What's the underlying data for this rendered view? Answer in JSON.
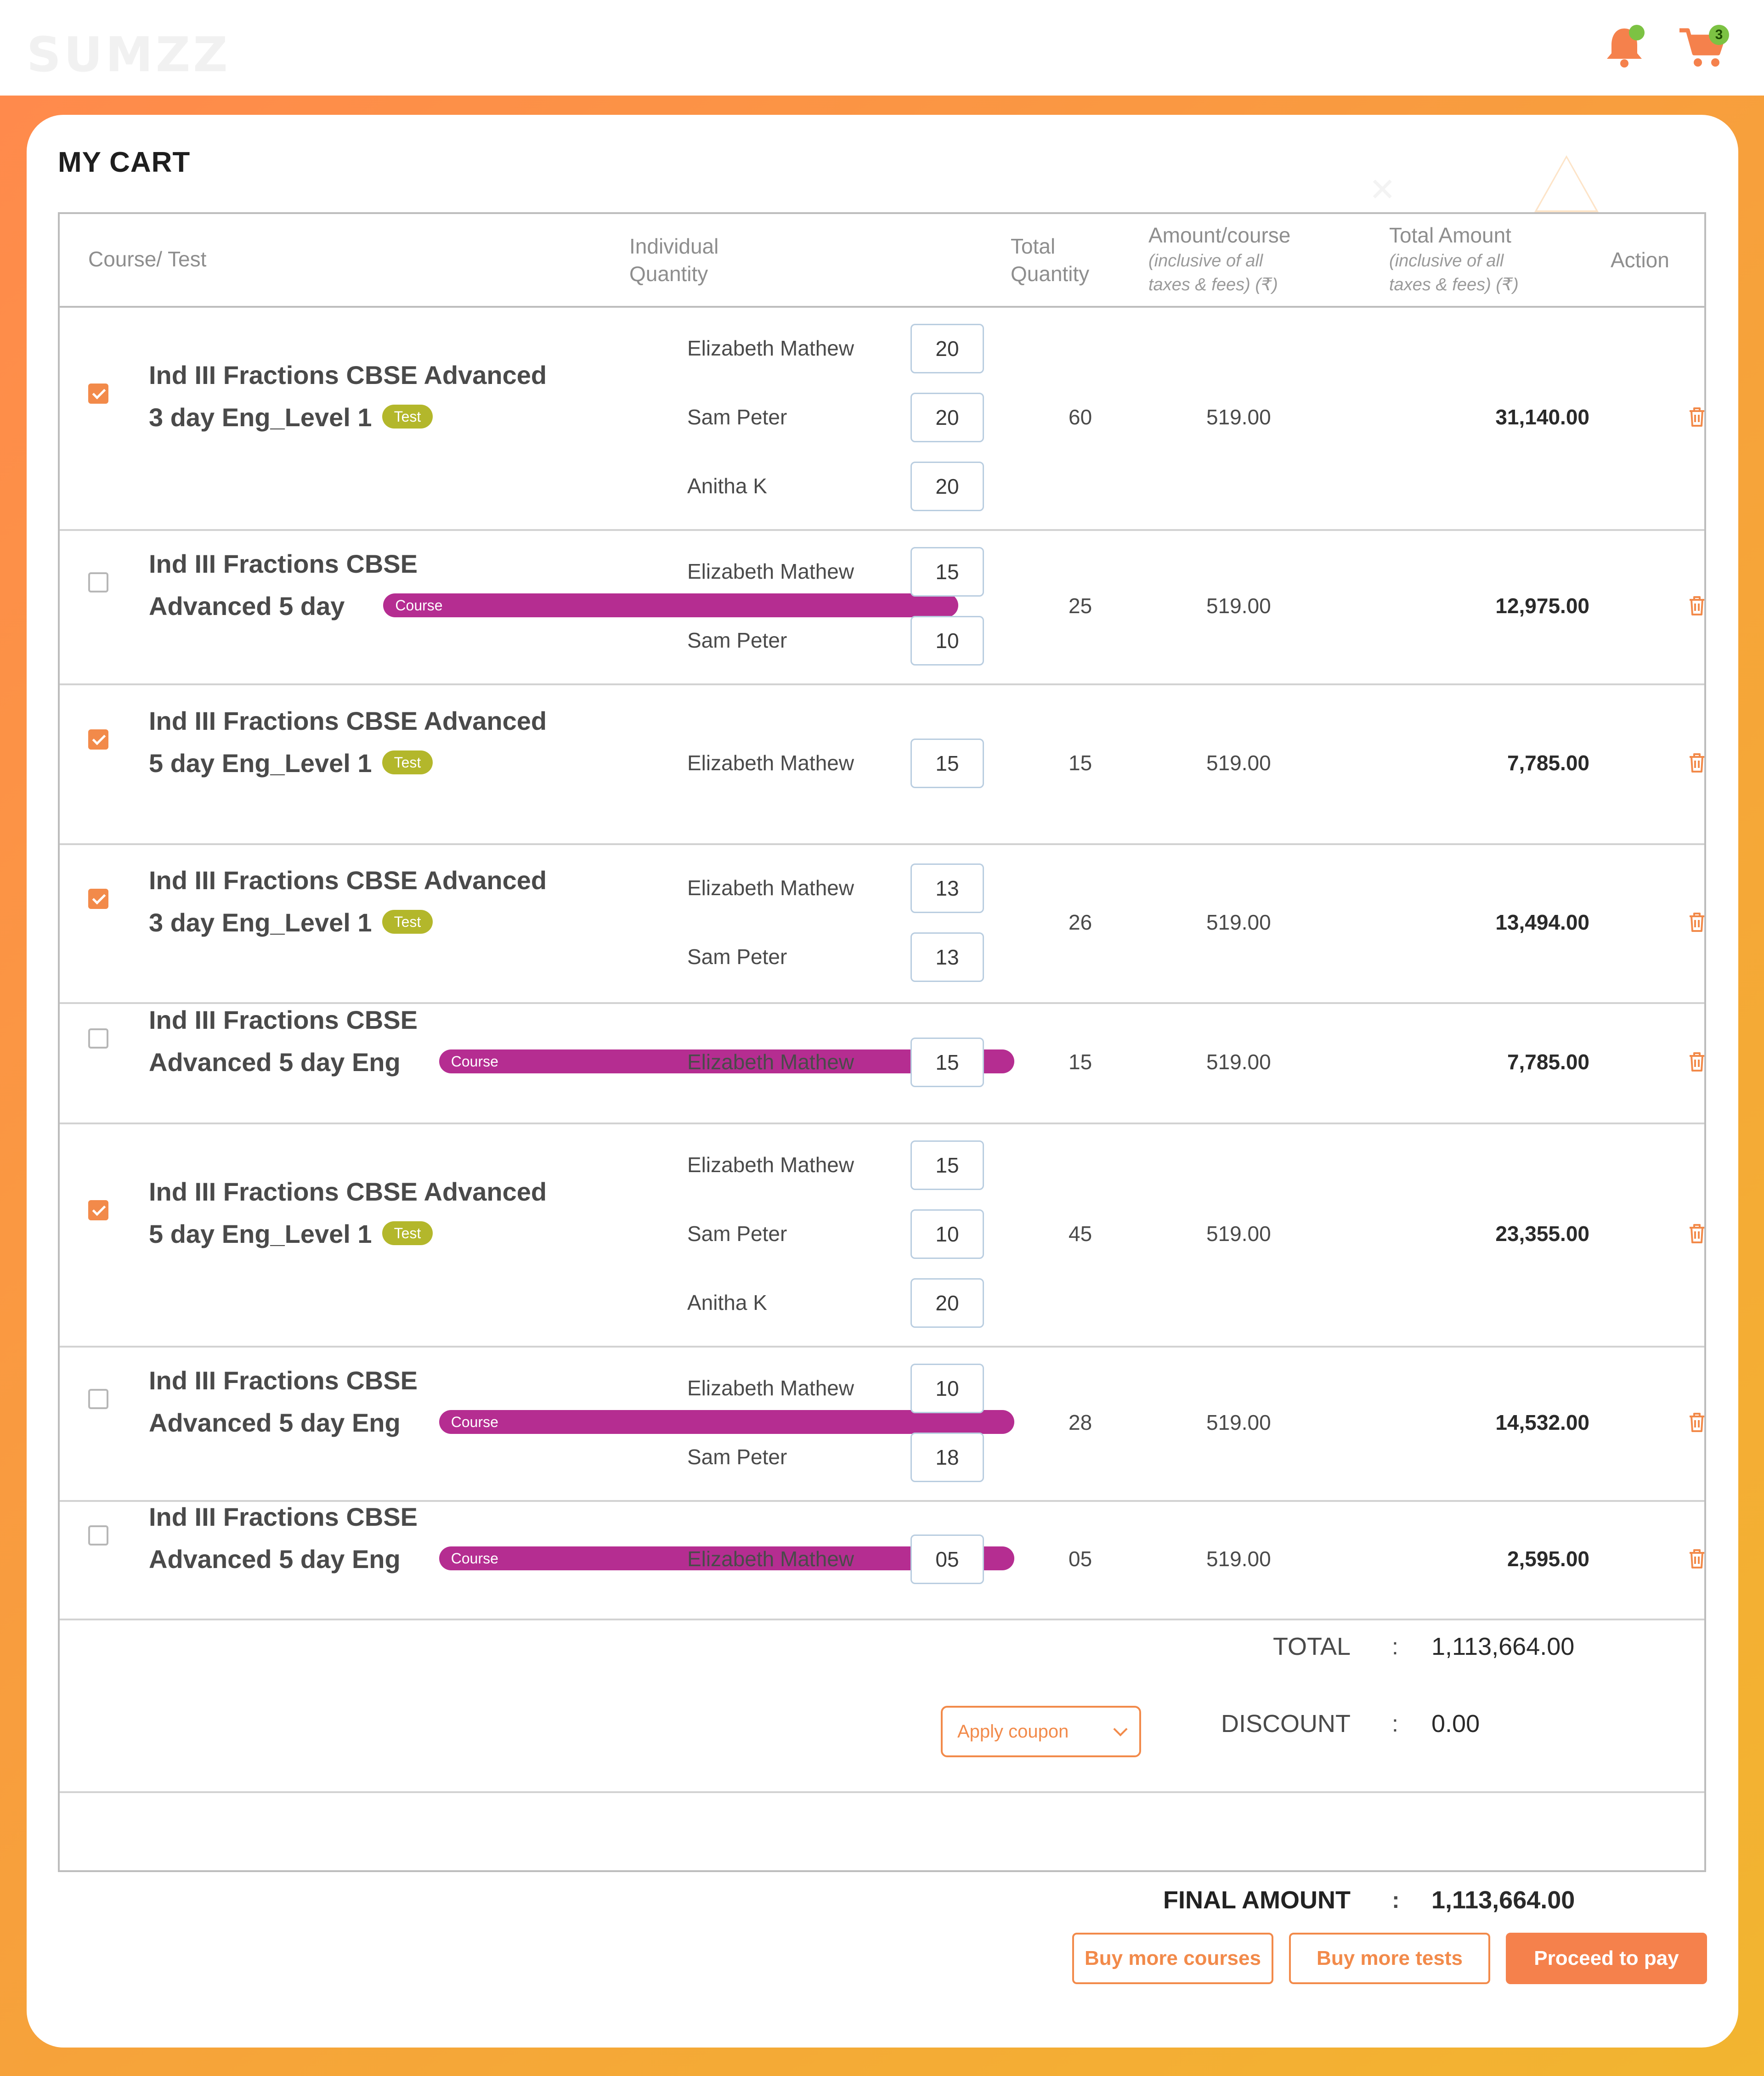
{
  "header": {
    "logo": "SUMZZ",
    "cart_count": "3"
  },
  "page": {
    "title": "MY CART"
  },
  "columns": {
    "course": "Course/ Test",
    "individual_qty_1": "Individual",
    "individual_qty_2": "Quantity",
    "total_qty_1": "Total",
    "total_qty_2": "Quantity",
    "amount_main": "Amount/course",
    "amount_sub_1": "(inclusive of all",
    "amount_sub_2": "taxes & fees) (₹)",
    "total_main": "Total Amount",
    "total_sub_1": "(inclusive of all",
    "total_sub_2": "taxes & fees) (₹)",
    "action": "Action"
  },
  "rows": [
    {
      "checked": true,
      "line1": "Ind III Fractions CBSE Advanced",
      "line2": "3 day Eng_Level 1",
      "tag": "Test",
      "tag_type": "test",
      "people": [
        {
          "name": "Elizabeth Mathew",
          "qty": "20"
        },
        {
          "name": "Sam Peter",
          "qty": "20"
        },
        {
          "name": "Anitha K",
          "qty": "20"
        }
      ],
      "total_qty": "60",
      "amount": "519.00",
      "total": "31,140.00"
    },
    {
      "checked": false,
      "line1": "Ind III Fractions CBSE",
      "line2": "Advanced 5 day",
      "tag": "Course",
      "tag_type": "course",
      "people": [
        {
          "name": "Elizabeth Mathew",
          "qty": "15"
        },
        {
          "name": "Sam Peter",
          "qty": "10"
        }
      ],
      "total_qty": "25",
      "amount": "519.00",
      "total": "12,975.00"
    },
    {
      "checked": true,
      "line1": "Ind III Fractions CBSE Advanced",
      "line2": "5 day Eng_Level 1",
      "tag": "Test",
      "tag_type": "test",
      "people": [
        {
          "name": "Elizabeth Mathew",
          "qty": "15"
        }
      ],
      "total_qty": "15",
      "amount": "519.00",
      "total": "7,785.00"
    },
    {
      "checked": true,
      "line1": "Ind III Fractions CBSE Advanced",
      "line2": "3 day Eng_Level 1",
      "tag": "Test",
      "tag_type": "test",
      "people": [
        {
          "name": "Elizabeth Mathew",
          "qty": "13"
        },
        {
          "name": "Sam Peter",
          "qty": "13"
        }
      ],
      "total_qty": "26",
      "amount": "519.00",
      "total": "13,494.00"
    },
    {
      "checked": false,
      "line1": "Ind III Fractions CBSE",
      "line2": "Advanced 5 day Eng",
      "tag": "Course",
      "tag_type": "course",
      "people": [
        {
          "name": "Elizabeth Mathew",
          "qty": "15"
        }
      ],
      "total_qty": "15",
      "amount": "519.00",
      "total": "7,785.00"
    },
    {
      "checked": true,
      "line1": "Ind III Fractions CBSE Advanced",
      "line2": "5 day Eng_Level 1",
      "tag": "Test",
      "tag_type": "test",
      "people": [
        {
          "name": "Elizabeth Mathew",
          "qty": "15"
        },
        {
          "name": "Sam Peter",
          "qty": "10"
        },
        {
          "name": "Anitha K",
          "qty": "20"
        }
      ],
      "total_qty": "45",
      "amount": "519.00",
      "total": "23,355.00"
    },
    {
      "checked": false,
      "line1": "Ind III Fractions CBSE",
      "line2": "Advanced 5 day Eng",
      "tag": "Course",
      "tag_type": "course",
      "people": [
        {
          "name": "Elizabeth Mathew",
          "qty": "10"
        },
        {
          "name": "Sam Peter",
          "qty": "18"
        }
      ],
      "total_qty": "28",
      "amount": "519.00",
      "total": "14,532.00"
    },
    {
      "checked": false,
      "line1": "Ind III Fractions CBSE",
      "line2": "Advanced 5 day Eng",
      "tag": "Course",
      "tag_type": "course",
      "people": [
        {
          "name": "Elizabeth Mathew",
          "qty": "05"
        }
      ],
      "total_qty": "05",
      "amount": "519.00",
      "total": "2,595.00"
    }
  ],
  "summary": {
    "total_label": "TOTAL",
    "total_value": "1,113,664.00",
    "coupon_placeholder": "Apply coupon",
    "discount_label": "DISCOUNT",
    "discount_value": "0.00",
    "final_label": "FINAL AMOUNT",
    "final_value": "1,113,664.00",
    "colon": ":"
  },
  "actions": {
    "buy_courses": "Buy more courses",
    "buy_tests": "Buy more tests",
    "proceed": "Proceed to pay"
  },
  "colors": {
    "accent": "#f28a4a",
    "test_tag": "#b3b72b",
    "course_tag": "#b52d91",
    "notify_dot": "#7cc243"
  }
}
